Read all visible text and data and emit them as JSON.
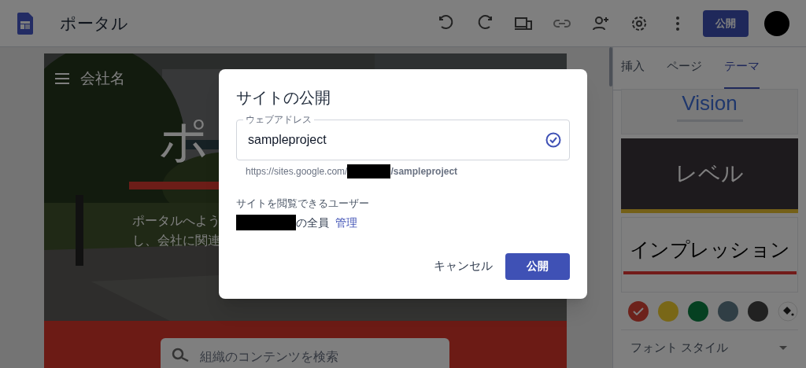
{
  "app_bar": {
    "title": "ポータル",
    "publish_button": "公開"
  },
  "editor": {
    "site_name": "会社名",
    "title_fragment": "ポ",
    "intro_lines": [
      "ポータルへよう",
      "し、会社に関連"
    ],
    "search": {
      "placeholder": "組織のコンテンツを検索"
    }
  },
  "side_panel": {
    "tabs": [
      {
        "label": "挿入",
        "selected": false
      },
      {
        "label": "ページ",
        "selected": false
      },
      {
        "label": "テーマ",
        "selected": true
      }
    ],
    "themes": [
      {
        "kind": "vision",
        "label": "Vision"
      },
      {
        "kind": "level",
        "label": "レベル"
      },
      {
        "kind": "impression",
        "label": "インプレッション"
      }
    ],
    "colors": [
      {
        "color": "#6d221b",
        "selected": true
      },
      {
        "color": "#796717",
        "selected": false
      },
      {
        "color": "#054021",
        "selected": false
      },
      {
        "color": "#303e45",
        "selected": false
      },
      {
        "color": "#212121",
        "selected": false
      }
    ],
    "font_style": "フォント スタイル"
  },
  "dialog": {
    "title": "サイトの公開",
    "field_label": "ウェブアドレス",
    "field_value": "sampleproject",
    "url_prefix": "https://sites.google.com/",
    "url_suffix": "/sampleproject",
    "viewers_label": "サイトを閲覧できるユーザー",
    "viewers_suffix": "の全員",
    "manage_link": "管理",
    "cancel_button": "キャンセル",
    "publish_button": "公開"
  }
}
